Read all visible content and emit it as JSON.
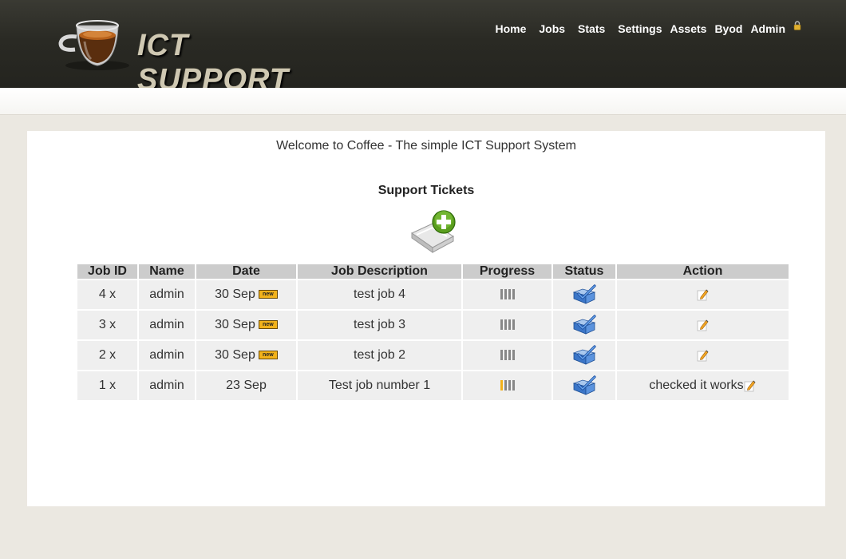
{
  "header": {
    "logo_text": "ICT SUPPORT",
    "nav": [
      "Home",
      "Jobs",
      "Stats",
      "Settings",
      "Assets",
      "Byod",
      "Admin"
    ]
  },
  "main": {
    "welcome": "Welcome to Coffee - The simple ICT Support System",
    "tickets_title": "Support Tickets"
  },
  "table": {
    "columns": [
      "Job ID",
      "Name",
      "Date",
      "Job Description",
      "Progress",
      "Status",
      "Action"
    ],
    "rows": [
      {
        "job_id": "4 x",
        "name": "admin",
        "date": "30 Sep",
        "new_badge": "new",
        "description": "test job 4",
        "progress": 0,
        "action_note": ""
      },
      {
        "job_id": "3 x",
        "name": "admin",
        "date": "30 Sep",
        "new_badge": "new",
        "description": "test job 3",
        "progress": 0,
        "action_note": ""
      },
      {
        "job_id": "2 x",
        "name": "admin",
        "date": "30 Sep",
        "new_badge": "new",
        "description": "test job 2",
        "progress": 0,
        "action_note": ""
      },
      {
        "job_id": "1 x",
        "name": "admin",
        "date": "23 Sep",
        "new_badge": "",
        "description": "Test job number 1",
        "progress": 1,
        "action_note": "checked it works"
      }
    ],
    "progress_steps": 4
  },
  "icons": {
    "cup": "coffee-cup-icon",
    "lock": "lock-icon",
    "add": "add-ticket-icon",
    "status": "folder-check-icon",
    "edit": "edit-icon"
  },
  "colors": {
    "header_bg": "#2a2a24",
    "background": "#ebe8e1",
    "table_header": "#cccccc",
    "row_bg": "#efefef",
    "accent": "#f2b21b"
  }
}
